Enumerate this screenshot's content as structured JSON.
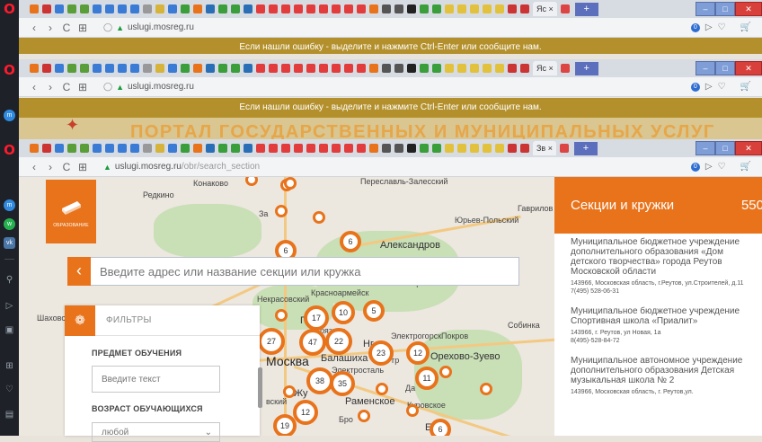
{
  "colors": {
    "accent": "#e8731b",
    "notice_bar": "#b3902c",
    "tab_plus": "#5b6fbc",
    "close": "#d8413b"
  },
  "left_bar": {
    "icons": [
      "opera-logo",
      "opera-logo",
      "opera-logo",
      "messenger-icon",
      "whatsapp-icon",
      "vk-icon",
      "search-icon",
      "send-icon",
      "camera-icon",
      "grid-icon",
      "heart-icon",
      "news-icon"
    ]
  },
  "windows": [
    {
      "url": "uslugi.mosreg.ru",
      "notice": "Если нашли ошибку - выделите и нажмите Ctrl-Enter или сообщите нам.",
      "tab_label": "Яс ×"
    },
    {
      "url": "uslugi.mosreg.ru",
      "notice": "Если нашли ошибку - выделите и нажмите Ctrl-Enter или сообщите нам.",
      "tab_label": "Яс ×"
    },
    {
      "url_host": "uslugi.mosreg.ru",
      "url_path": "/obr/search_section",
      "tab_label": "Зв ×"
    }
  ],
  "banner_title": "ПОРТАЛ ГОСУДАРСТВЕННЫХ И МУНИЦИПАЛЬНЫХ УСЛУГ",
  "address_badge": "0",
  "page": {
    "edu_tile_caption": "ОБРАЗОВАНИЕ",
    "search_placeholder": "Введите адрес или название секции или кружка",
    "filters": {
      "title": "ФИЛЬТРЫ",
      "subject_label": "ПРЕДМЕТ ОБУЧЕНИЯ",
      "subject_placeholder": "Введите текст",
      "age_label": "ВОЗРАСТ ОБУЧАЮЩИХСЯ",
      "age_value": "любой"
    },
    "results": {
      "title": "Секции и кружки",
      "count": "550",
      "items": [
        {
          "name": "Муниципальное бюджетное учреждение дополнительного образования «Дом детского творчества» города Реутов Московской области",
          "address": "143966, Московская область, г.Реутов, ул.Строителей, д.11",
          "phone": "7(495) 528-06-31"
        },
        {
          "name": "Муниципальное бюджетное учреждение Спортивная школа «Приалит»",
          "address": "143966, г. Реутов, ул Новая, 1а",
          "phone": "8(495)-528-84-72"
        },
        {
          "name": "Муниципальное автономное учреждение дополнительного образования Детская музыкальная школа № 2",
          "address": "143966, Московская область, г. Реутов,ул.",
          "phone": ""
        }
      ]
    }
  },
  "map": {
    "labels": {
      "redkino": "Редкино",
      "konakovo": "Конаково",
      "pereslavl": "Переславль-Залесский",
      "gavrilov": "Гаврилов",
      "yuryev": "Юрьев-Польский",
      "aleksandrov": "Александров",
      "za": "За",
      "krasnoarmeysk": "Красноармейск",
      "kirzhach": "Киржач",
      "nekrasovsky": "Некрасовский",
      "shakhovskaya": "Шаховс",
      "moskva": "Москва",
      "balashikha": "Балашиха",
      "elektrostal": "Электросталь",
      "orekhovo": "Орехово-Зуево",
      "ramenskoe": "Раменское",
      "kurovskoe": "Куровское",
      "sobinka": "Собинка",
      "pokrov": "Покров",
      "elektrogorsk": "Электрогорск",
      "zhu": "Жу",
      "fryazino": "рязино",
      "egor": "Его",
      "brg": "Бро",
      "vsk": "вский",
      "ng": "Нг",
      "gr": "гр",
      "da": "Да",
      "g": "Г"
    },
    "clusters": [
      "6",
      "6",
      "17",
      "10",
      "5",
      "27",
      "47",
      "22",
      "23",
      "12",
      "38",
      "35",
      "11",
      "12",
      "19",
      "6"
    ]
  }
}
